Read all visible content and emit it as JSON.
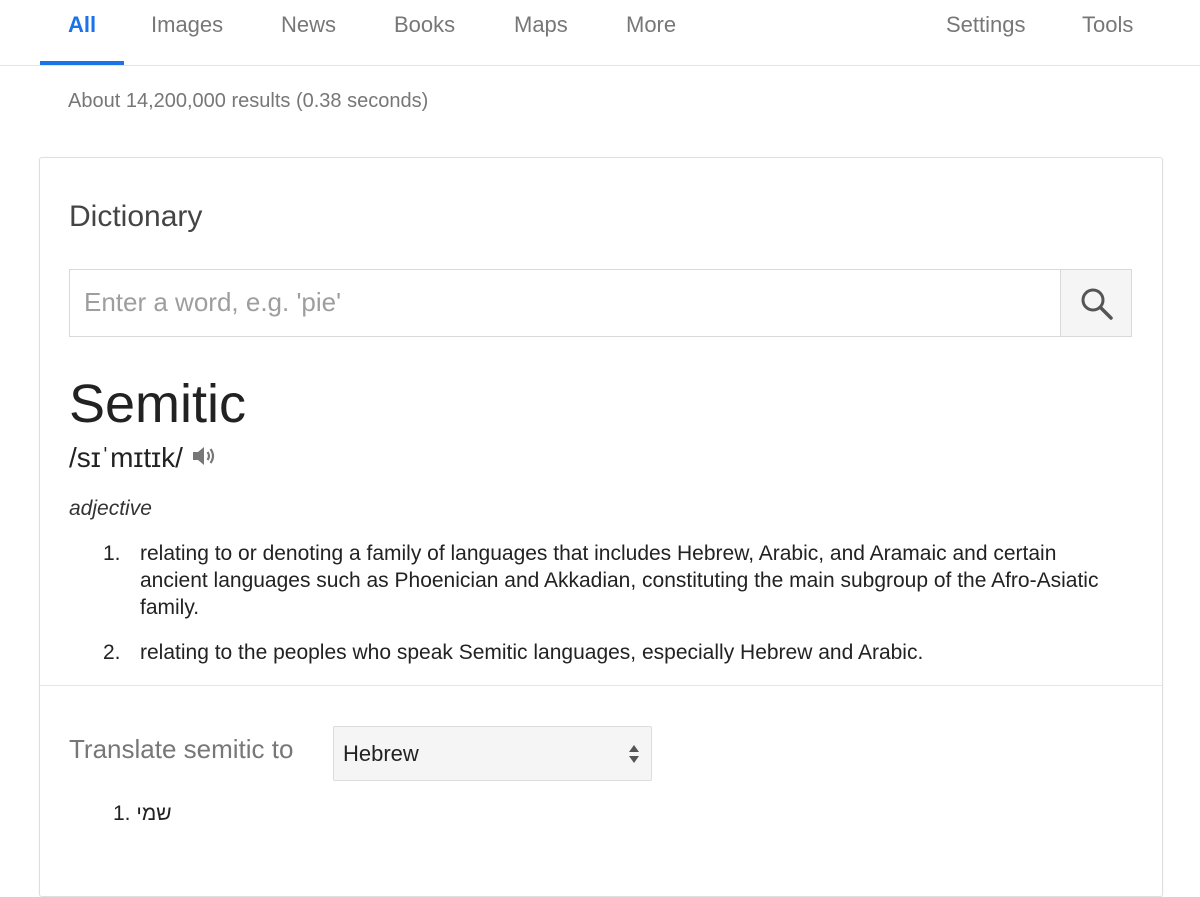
{
  "nav": {
    "tabs": [
      {
        "label": "All",
        "active": true
      },
      {
        "label": "Images"
      },
      {
        "label": "News"
      },
      {
        "label": "Books"
      },
      {
        "label": "Maps"
      },
      {
        "label": "More"
      }
    ],
    "settings_label": "Settings",
    "tools_label": "Tools"
  },
  "stats": "About 14,200,000 results (0.38 seconds)",
  "dictionary": {
    "title": "Dictionary",
    "search_placeholder": "Enter a word, e.g. 'pie'",
    "search_value": "",
    "search_icon": "search-icon",
    "word": "Semitic",
    "pronunciation": "/sɪˈmɪtɪk/",
    "speaker_icon": "speaker-icon",
    "part_of_speech": "adjective",
    "definitions": [
      {
        "num": "1.",
        "text": "relating to or denoting a family of languages that includes Hebrew, Arabic, and Aramaic and certain ancient languages such as Phoenician and Akkadian, constituting the main subgroup of the Afro-Asiatic family."
      },
      {
        "num": "2.",
        "text": "relating to the peoples who speak Semitic languages, especially Hebrew and Arabic."
      }
    ]
  },
  "translate": {
    "label": "Translate semitic to",
    "selected_language": "Hebrew",
    "results": [
      {
        "num": "1.",
        "text": "שמי"
      }
    ]
  },
  "colors": {
    "accent": "#1a73e8",
    "muted_text": "#777777",
    "border": "#dfdfdf"
  }
}
